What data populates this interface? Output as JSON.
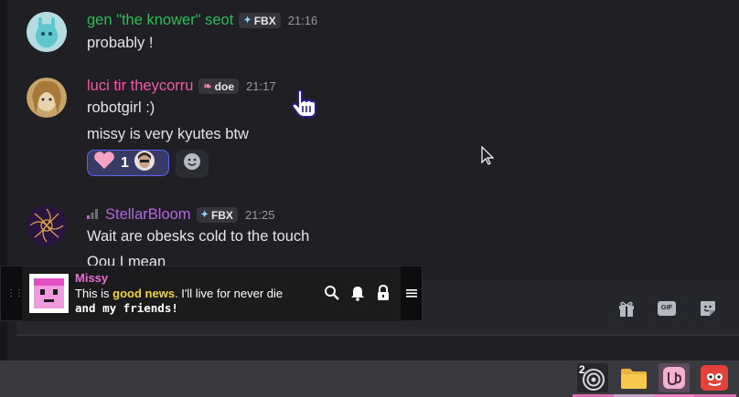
{
  "colors": {
    "accent": "#5865f2",
    "green_name": "#2ebd59",
    "pink_name": "#f15aa8",
    "purple_name": "#b267e0",
    "missy": "#ee6bd8",
    "highlight": "#f3d33a"
  },
  "messages": [
    {
      "username": "gen \"the knower\" seot",
      "tag": "FBX",
      "tag_icon": "sparkle-icon",
      "time": "21:16",
      "lines": [
        "probably !"
      ]
    },
    {
      "username": "luci tir theycorru",
      "tag": "doe",
      "tag_icon": "leaf-icon",
      "time": "21:17",
      "lines": [
        "robotgirl :)",
        "missy is very kyutes btw"
      ],
      "reaction": {
        "emoji": "heart",
        "count": "1"
      }
    },
    {
      "username": "StellarBloom",
      "tag": "FBX",
      "tag_icon": "sparkle-icon",
      "time": "21:25",
      "lines": [
        "Wait are obesks cold to the touch",
        "Qou I mean"
      ]
    }
  ],
  "overlay": {
    "name": "Missy",
    "line1_pre": "This is ",
    "line1_hl": "good news",
    "line1_post": ". I'll live for never die",
    "line2": "and my friends!",
    "buttons": [
      "search-icon",
      "bell-icon",
      "lock-icon",
      "menu-icon"
    ]
  },
  "composer": {
    "icons": [
      "gift-icon",
      "gif-icon",
      "sticker-icon"
    ],
    "gif_label": "GIF"
  },
  "taskbar": {
    "badge": "2",
    "items": [
      "activity-app",
      "file-manager",
      "discord-app",
      "game-app"
    ]
  }
}
